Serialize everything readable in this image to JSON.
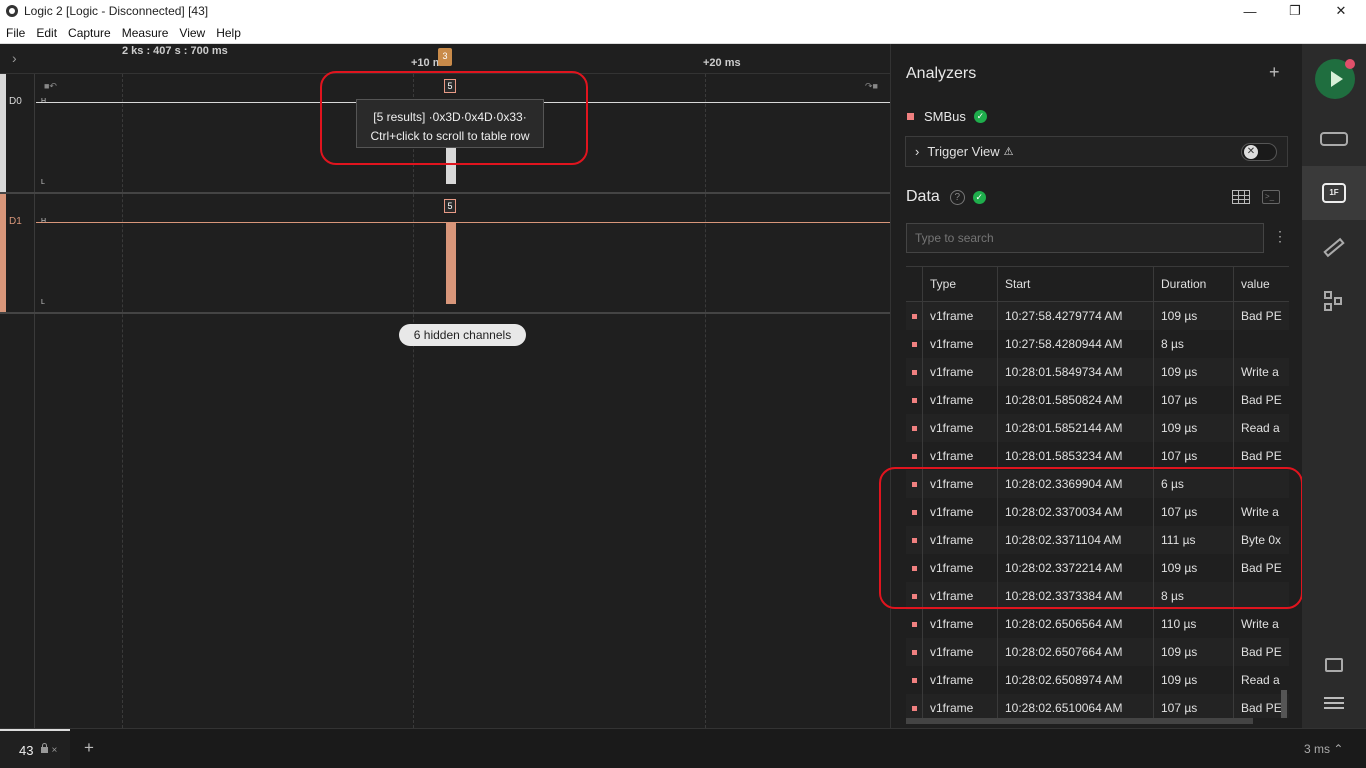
{
  "window": {
    "title": "Logic 2 [Logic - Disconnected] [43]",
    "minimize": "—",
    "maximize": "❐",
    "close": "✕"
  },
  "menu": [
    "File",
    "Edit",
    "Capture",
    "Measure",
    "View",
    "Help"
  ],
  "timebar": {
    "origin": "2 ks : 407 s : 700 ms",
    "tick1": "+10 ms",
    "tick2": "+20 ms",
    "marker": "3"
  },
  "channels": [
    {
      "name": "D0",
      "high": "H",
      "low": "L",
      "badge": "5",
      "color": "#d8d8d8"
    },
    {
      "name": "D1",
      "high": "H",
      "low": "L",
      "badge": "5",
      "color": "#d8967a"
    }
  ],
  "tooltip": {
    "line1": "[5 results] ·0x3D·0x4D·0x33·",
    "line2": "Ctrl+click to scroll to table row"
  },
  "hidden_channels": "6 hidden channels",
  "analyzers": {
    "title": "Analyzers",
    "add": "+",
    "smbus": "SMBus",
    "trigger_view": "Trigger View",
    "trigger_warning": "⚠"
  },
  "data_section": {
    "title": "Data",
    "help": "?",
    "search_placeholder": "Type to search",
    "kebab": "⋮",
    "columns": [
      "Type",
      "Start",
      "Duration",
      "value"
    ],
    "rows": [
      {
        "type": "v1frame",
        "start": "10:27:58.4279774 AM",
        "duration": "109 µs",
        "value": "Bad PE"
      },
      {
        "type": "v1frame",
        "start": "10:27:58.4280944 AM",
        "duration": "8 µs",
        "value": ""
      },
      {
        "type": "v1frame",
        "start": "10:28:01.5849734 AM",
        "duration": "109 µs",
        "value": "Write a"
      },
      {
        "type": "v1frame",
        "start": "10:28:01.5850824 AM",
        "duration": "107 µs",
        "value": "Bad PE"
      },
      {
        "type": "v1frame",
        "start": "10:28:01.5852144 AM",
        "duration": "109 µs",
        "value": "Read a"
      },
      {
        "type": "v1frame",
        "start": "10:28:01.5853234 AM",
        "duration": "107 µs",
        "value": "Bad PE"
      },
      {
        "type": "v1frame",
        "start": "10:28:02.3369904 AM",
        "duration": "6 µs",
        "value": ""
      },
      {
        "type": "v1frame",
        "start": "10:28:02.3370034 AM",
        "duration": "107 µs",
        "value": "Write a"
      },
      {
        "type": "v1frame",
        "start": "10:28:02.3371104 AM",
        "duration": "111 µs",
        "value": "Byte 0x"
      },
      {
        "type": "v1frame",
        "start": "10:28:02.3372214 AM",
        "duration": "109 µs",
        "value": "Bad PE"
      },
      {
        "type": "v1frame",
        "start": "10:28:02.3373384 AM",
        "duration": "8 µs",
        "value": ""
      },
      {
        "type": "v1frame",
        "start": "10:28:02.6506564 AM",
        "duration": "110 µs",
        "value": "Write a"
      },
      {
        "type": "v1frame",
        "start": "10:28:02.6507664 AM",
        "duration": "109 µs",
        "value": "Bad PE"
      },
      {
        "type": "v1frame",
        "start": "10:28:02.6508974 AM",
        "duration": "109 µs",
        "value": "Read a"
      },
      {
        "type": "v1frame",
        "start": "10:28:02.6510064 AM",
        "duration": "107 µs",
        "value": "Bad PE"
      }
    ]
  },
  "sidebar": {
    "analyzer_badge": "1F"
  },
  "bottom": {
    "tab_label": "43",
    "tab_close": "×",
    "add_tab": "+",
    "zoom": "3 ms ⌃"
  },
  "colors": {
    "accent_green": "#1fae4c",
    "highlight_red": "#e0141e",
    "d0": "#d8d8d8",
    "d1": "#d8967a"
  }
}
